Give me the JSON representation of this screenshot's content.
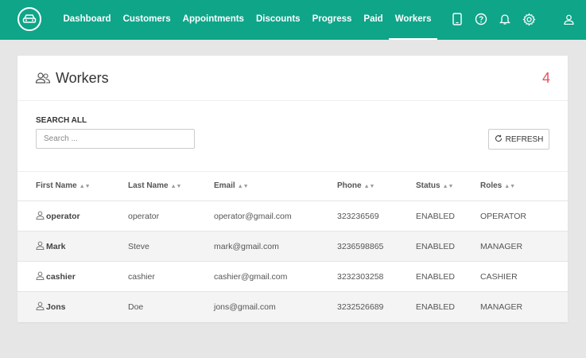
{
  "nav": {
    "items": [
      {
        "label": "Dashboard",
        "active": false
      },
      {
        "label": "Customers",
        "active": false
      },
      {
        "label": "Appointments",
        "active": false
      },
      {
        "label": "Discounts",
        "active": false
      },
      {
        "label": "Progress",
        "active": false
      },
      {
        "label": "Paid",
        "active": false
      },
      {
        "label": "Workers",
        "active": true
      }
    ],
    "icons": [
      "car-logo-icon",
      "tablet-icon",
      "help-icon",
      "bell-icon",
      "gear-icon",
      "user-icon"
    ]
  },
  "card": {
    "title": "Workers",
    "count": "4",
    "search_label": "SEARCH ALL",
    "search_placeholder": "Search ...",
    "search_value": "",
    "refresh_label": "REFRESH"
  },
  "table": {
    "columns": [
      "First Name",
      "Last Name",
      "Email",
      "Phone",
      "Status",
      "Roles"
    ],
    "rows": [
      [
        "operator",
        "operator",
        "operator@gmail.com",
        "323236569",
        "ENABLED",
        "OPERATOR"
      ],
      [
        "Mark",
        "Steve",
        "mark@gmail.com",
        "3236598865",
        "ENABLED",
        "MANAGER"
      ],
      [
        "cashier",
        "cashier",
        "cashier@gmail.com",
        "3232303258",
        "ENABLED",
        "CASHIER"
      ],
      [
        "Jons",
        "Doe",
        "jons@gmail.com",
        "3232526689",
        "ENABLED",
        "MANAGER"
      ]
    ]
  },
  "colors": {
    "accent": "#0ea589",
    "count": "#e8505b",
    "background": "#e6e6e6"
  }
}
